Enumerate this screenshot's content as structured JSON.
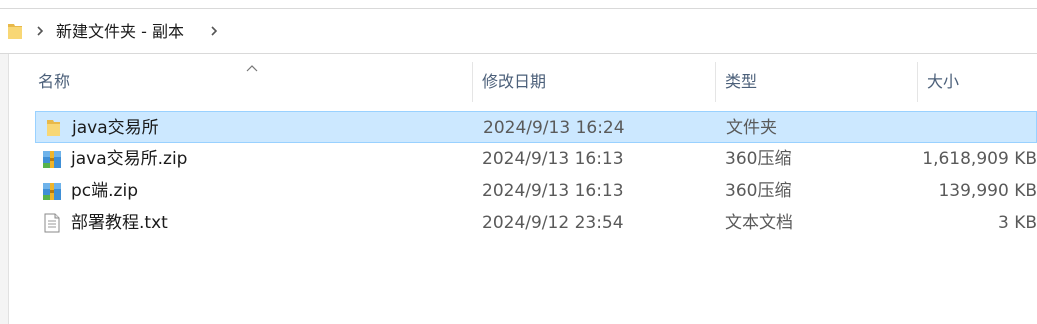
{
  "breadcrumb": {
    "items": [
      {
        "label": "新建文件夹 - 副本"
      }
    ]
  },
  "columns": {
    "name": "名称",
    "modified": "修改日期",
    "type": "类型",
    "size": "大小"
  },
  "files": [
    {
      "name": "java交易所",
      "modified": "2024/9/13 16:24",
      "type": "文件夹",
      "size": "",
      "icon": "folder-icon",
      "selected": true
    },
    {
      "name": "java交易所.zip",
      "modified": "2024/9/13 16:13",
      "type": "360压缩",
      "size": "1,618,909 KB",
      "icon": "zip-archive-icon",
      "selected": false
    },
    {
      "name": "pc端.zip",
      "modified": "2024/9/13 16:13",
      "type": "360压缩",
      "size": "139,990 KB",
      "icon": "zip-archive-icon",
      "selected": false
    },
    {
      "name": "部署教程.txt",
      "modified": "2024/9/12 23:54",
      "type": "文本文档",
      "size": "3 KB",
      "icon": "text-file-icon",
      "selected": false
    }
  ],
  "colors": {
    "selection_bg": "#cce8ff",
    "selection_border": "#99d1ff",
    "header_text": "#4c607a",
    "folder_yellow": "#f8d775"
  }
}
